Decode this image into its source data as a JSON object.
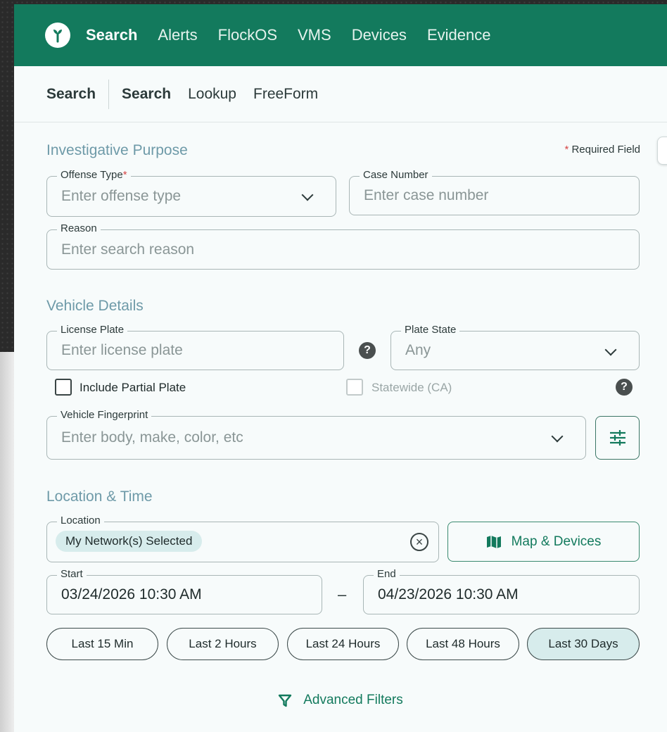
{
  "nav": {
    "items": [
      "Search",
      "Alerts",
      "FlockOS",
      "VMS",
      "Devices",
      "Evidence"
    ]
  },
  "subnav": {
    "title": "Search",
    "tabs": [
      "Search",
      "Lookup",
      "FreeForm"
    ]
  },
  "sections": {
    "investigative": "Investigative Purpose",
    "vehicle": "Vehicle Details",
    "location_time": "Location & Time"
  },
  "required_note": {
    "star": "*",
    "text": " Required Field"
  },
  "fields": {
    "offense_type": {
      "label": "Offense Type",
      "star": "*",
      "placeholder": "Enter offense type"
    },
    "case_number": {
      "label": "Case Number",
      "placeholder": "Enter case number"
    },
    "reason": {
      "label": "Reason",
      "placeholder": "Enter search reason"
    },
    "license_plate": {
      "label": "License Plate",
      "placeholder": "Enter license plate"
    },
    "plate_state": {
      "label": "Plate State",
      "value": "Any"
    },
    "fingerprint": {
      "label": "Vehicle Fingerprint",
      "placeholder": "Enter body, make, color, etc"
    },
    "location": {
      "label": "Location",
      "chip": "My Network(s) Selected"
    },
    "start": {
      "label": "Start",
      "value": "03/24/2026 10:30 AM"
    },
    "end": {
      "label": "End",
      "value": "04/23/2026 10:30 AM"
    }
  },
  "checkboxes": {
    "partial_plate": "Include Partial Plate",
    "statewide": "Statewide (CA)"
  },
  "help_glyph": "?",
  "date_separator": "–",
  "map_button": "Map & Devices",
  "time_ranges": [
    "Last 15 Min",
    "Last 2 Hours",
    "Last 24 Hours",
    "Last 48 Hours",
    "Last 30 Days"
  ],
  "selected_range": "Last 30 Days",
  "advanced_filters": "Advanced Filters",
  "colors": {
    "brand": "#137a5d",
    "section": "#6e9aa8",
    "chip": "#d7ecec",
    "required": "#d64545"
  },
  "icons": [
    "flock-logo-icon",
    "chevron-down-icon",
    "help-icon",
    "sliders-icon",
    "clear-icon",
    "map-icon",
    "filter-icon"
  ]
}
